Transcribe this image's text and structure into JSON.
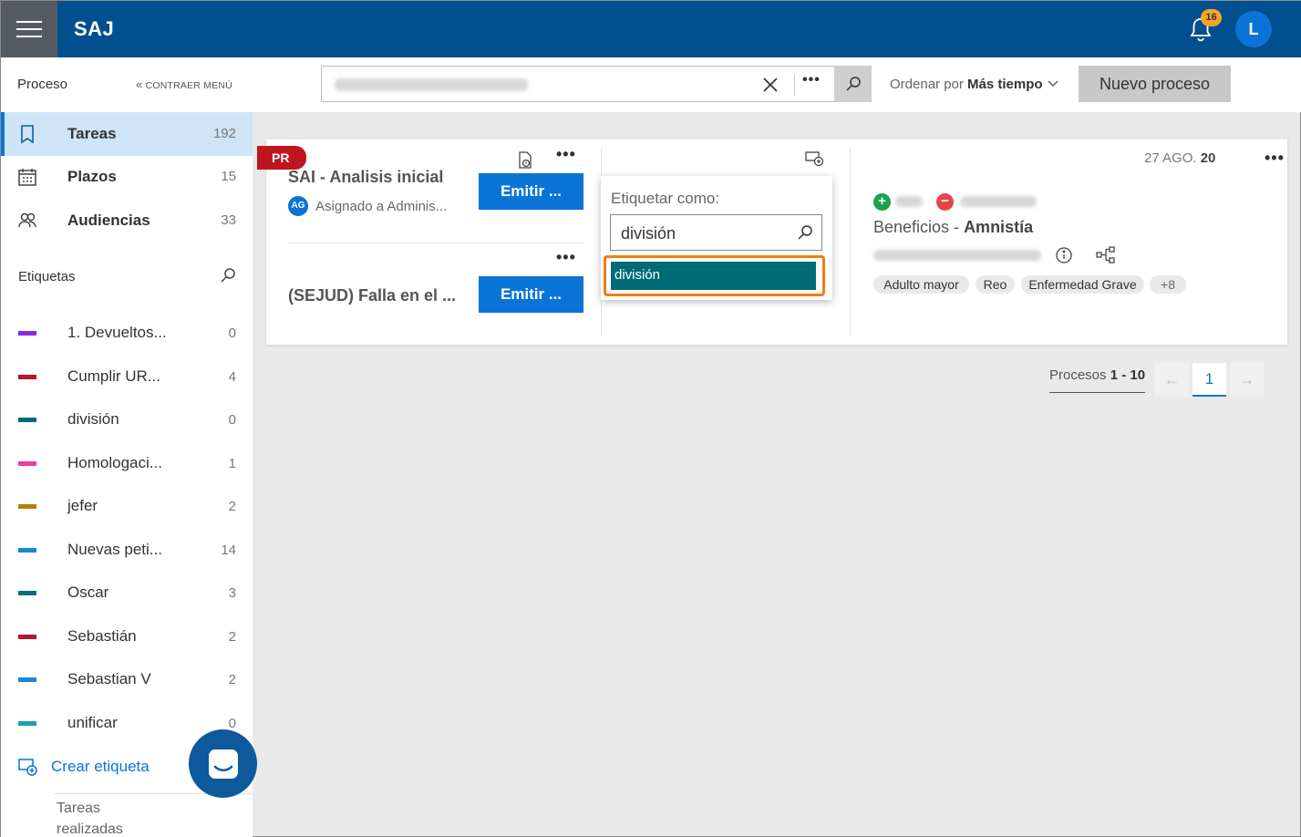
{
  "header": {
    "brand": "SAJ",
    "notifications": "16",
    "avatar_initial": "L"
  },
  "sidebar": {
    "section_title": "Proceso",
    "collapse_label": "CONTRAER MENÚ",
    "nav": [
      {
        "label": "Tareas",
        "count": "192",
        "icon": "bookmark-icon"
      },
      {
        "label": "Plazos",
        "count": "15",
        "icon": "calendar-icon"
      },
      {
        "label": "Audiencias",
        "count": "33",
        "icon": "people-icon"
      }
    ],
    "tags_title": "Etiquetas",
    "tags": [
      {
        "label": "1. Devueltos...",
        "count": "0",
        "color": "#8a2be2"
      },
      {
        "label": "Cumplir UR...",
        "count": "4",
        "color": "#b5172b"
      },
      {
        "label": "división",
        "count": "0",
        "color": "#006b75"
      },
      {
        "label": "Homologaci...",
        "count": "1",
        "color": "#e83fa8"
      },
      {
        "label": "jefer",
        "count": "2",
        "color": "#b87d0a"
      },
      {
        "label": "Nuevas peti...",
        "count": "14",
        "color": "#1a86d6"
      },
      {
        "label": "Oscar",
        "count": "3",
        "color": "#00707a"
      },
      {
        "label": "Sebastián",
        "count": "2",
        "color": "#b5172b"
      },
      {
        "label": "Sebastian V",
        "count": "2",
        "color": "#1a86d6"
      },
      {
        "label": "unificar",
        "count": "0",
        "color": "#1aa0a8"
      }
    ],
    "create_tag": "Crear etiqueta",
    "done_tasks": "Tareas realizadas"
  },
  "toolbar": {
    "sort_prefix": "Ordenar por",
    "sort_value": "Más tiempo",
    "new_process": "Nuevo proceso",
    "more": "•••"
  },
  "card": {
    "badge": "PR",
    "tasks": [
      {
        "title": "SAI - Analisis inicial",
        "button": "Emitir ...",
        "assignee_initials": "AG",
        "assignee": "Asignado a Adminis..."
      },
      {
        "title": "(SEJUD) Falla en el ...",
        "button": "Emitir ..."
      }
    ],
    "date_prefix": "27 AGO.",
    "date_year": "20",
    "subject_prefix": "Beneficios -",
    "subject_bold": "Amnistía",
    "chips": [
      "Adulto mayor",
      "Reo",
      "Enfermedad Grave",
      "+8"
    ],
    "dots": "•••"
  },
  "popup": {
    "title": "Etiquetar como:",
    "input_value": "división",
    "option": "división"
  },
  "pagination": {
    "prefix": "Procesos",
    "range": "1 - 10",
    "current_page": "1",
    "prev": "←",
    "next": "→"
  }
}
